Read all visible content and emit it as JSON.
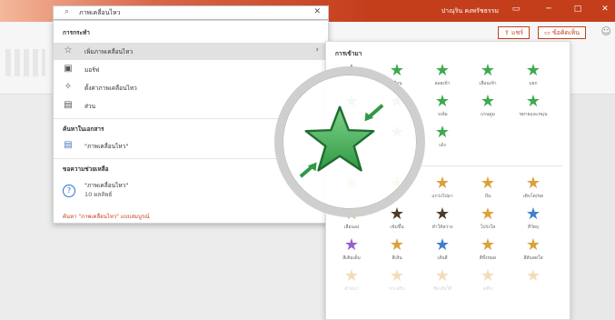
{
  "window": {
    "user_name": "ปาณุริน คงพรัชธรรม",
    "share_label": "แชร์",
    "comment_label": "ข้อคิดเห็น"
  },
  "search": {
    "value": "ภาพเคลื่อนไหว"
  },
  "dropdown": {
    "actions_header": "การกระทำ",
    "actions": [
      {
        "label": "เพิ่มภาพเคลื่อนไหว",
        "icon": "star-add-icon"
      },
      {
        "label": "มอร์ฟ",
        "icon": "morph-icon"
      },
      {
        "label": "ตั้งค่าภาพเคลื่อนไหว",
        "icon": "animation-settings-icon"
      },
      {
        "label": "ส่วน",
        "icon": "section-icon"
      }
    ],
    "documents_header": "ค้นหาในเอกสาร",
    "documents": [
      {
        "label": "\"ภาพเคลื่อนไหว\"",
        "icon": "document-search-icon"
      }
    ],
    "help_header": "ขอความช่วยเหลือ",
    "help": [
      {
        "label": "\"ภาพเคลื่อนไหว\"",
        "sub": "10 ผลลัพธ์",
        "icon": "help-icon"
      }
    ],
    "more_link": "ค้นหา \"ภาพเคลื่อนไหว\" แบบสมบูรณ์"
  },
  "gallery": {
    "header": "การเข้ามา",
    "colors": {
      "green": "#3daa4f",
      "gold": "#d9a23a",
      "accent": "#c43e1c"
    },
    "entrance": [
      {
        "label": ""
      },
      {
        "label": "เลือน"
      },
      {
        "label": "ลอยเข้า"
      },
      {
        "label": "เลือนเข้า"
      },
      {
        "label": "แยก"
      },
      {
        "label": ""
      },
      {
        "label": ""
      },
      {
        "label": "วงล้อ"
      },
      {
        "label": "แรนดูม"
      },
      {
        "label": "ขยายและหมุน"
      },
      {
        "label": ""
      },
      {
        "label": ""
      },
      {
        "label": "เด้ง"
      }
    ],
    "emphasis": [
      {
        "label": ""
      },
      {
        "label": "พัลส์"
      },
      {
        "label": "แกว่งไปมา"
      },
      {
        "label": "ปั่น"
      },
      {
        "label": "เติบโต/หด"
      },
      {
        "label": "เลือนลง"
      },
      {
        "label": "เข้มขึ้น"
      },
      {
        "label": "ทำให้สว่าง"
      },
      {
        "label": "โปร่งใส"
      },
      {
        "label": "สีวัตถุ"
      },
      {
        "label": "สีเติมเต็ม"
      },
      {
        "label": "สีเส้น"
      },
      {
        "label": "เส้นสี"
      },
      {
        "label": "สีทั้งหมด"
      },
      {
        "label": "สีสันสดใส"
      },
      {
        "label": "ตัวหนา"
      },
      {
        "label": "กระพริบ"
      },
      {
        "label": "ขีดเส้นใต้"
      },
      {
        "label": "คลื่น"
      },
      {
        "label": ""
      }
    ]
  }
}
